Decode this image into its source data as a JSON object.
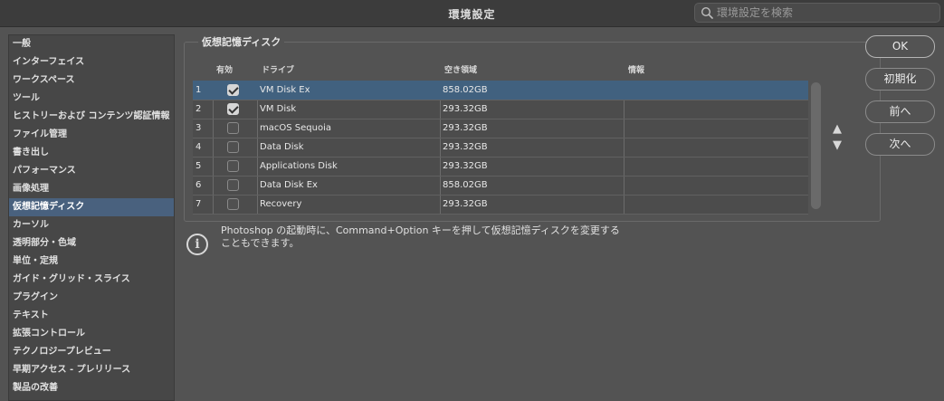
{
  "window": {
    "title": "環境設定",
    "search_placeholder": "環境設定を検索"
  },
  "sidebar": {
    "items": [
      "一般",
      "インターフェイス",
      "ワークスペース",
      "ツール",
      "ヒストリーおよび コンテンツ認証情報",
      "ファイル管理",
      "書き出し",
      "パフォーマンス",
      "画像処理",
      "仮想記憶ディスク",
      "カーソル",
      "透明部分・色域",
      "単位・定規",
      "ガイド・グリッド・スライス",
      "プラグイン",
      "テキスト",
      "拡張コントロール",
      "テクノロジープレビュー",
      "早期アクセス - プレリリース",
      "製品の改善"
    ],
    "active_index": 9
  },
  "scratch": {
    "group_label": "仮想記憶ディスク",
    "columns": {
      "active": "有効",
      "drive": "ドライブ",
      "free": "空き領域",
      "info": "情報"
    },
    "rows": [
      {
        "num": "1",
        "checked": true,
        "drive": "VM Disk Ex",
        "free": "858.02GB",
        "info": ""
      },
      {
        "num": "2",
        "checked": true,
        "drive": "VM Disk",
        "free": "293.32GB",
        "info": ""
      },
      {
        "num": "3",
        "checked": false,
        "drive": "macOS Sequoia",
        "free": "293.32GB",
        "info": ""
      },
      {
        "num": "4",
        "checked": false,
        "drive": "Data Disk",
        "free": "293.32GB",
        "info": ""
      },
      {
        "num": "5",
        "checked": false,
        "drive": "Applications Disk",
        "free": "293.32GB",
        "info": ""
      },
      {
        "num": "6",
        "checked": false,
        "drive": "Data Disk Ex",
        "free": "858.02GB",
        "info": ""
      },
      {
        "num": "7",
        "checked": false,
        "drive": "Recovery",
        "free": "293.32GB",
        "info": ""
      }
    ],
    "selected_row": 0,
    "move_up": "▲",
    "move_down": "▼"
  },
  "note": {
    "icon": "i",
    "line1": "Photoshop の起動時に、Command+Option キーを押して仮想記憶ディスクを変更する",
    "line2": "こともできます。"
  },
  "buttons": {
    "ok": "OK",
    "reset": "初期化",
    "prev": "前へ",
    "next": "次へ"
  },
  "colors": {
    "background": "#535353",
    "selection": "#49617e",
    "row_selection": "#41617f"
  }
}
